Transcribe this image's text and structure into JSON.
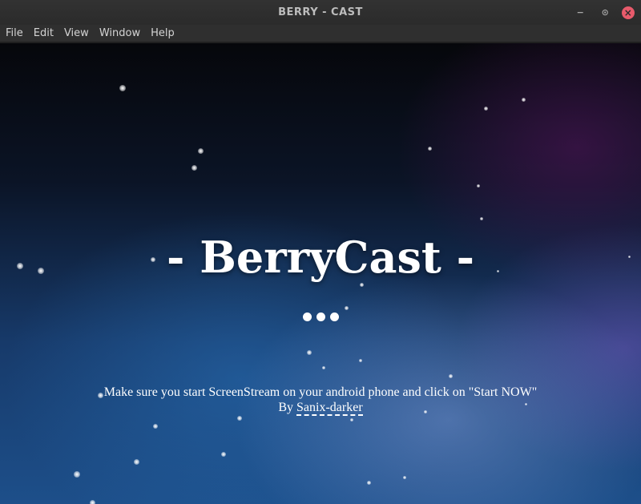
{
  "window": {
    "title": "BERRY - CAST",
    "controls": {
      "minimize": "−",
      "restore": "⊙",
      "close": "×"
    }
  },
  "menubar": {
    "items": [
      "File",
      "Edit",
      "View",
      "Window",
      "Help"
    ]
  },
  "main": {
    "headline": "- BerryCast -",
    "instruction": "Make sure you start ScreenStream on your android phone and click on \"Start NOW\"",
    "byline_prefix": "By ",
    "author": "Sanix-darker"
  },
  "colors": {
    "close_button": "#e85a6b",
    "titlebar": "#2f2f2f",
    "text": "#ffffff"
  },
  "icons": [
    "minimize-icon",
    "restore-icon",
    "close-icon"
  ]
}
